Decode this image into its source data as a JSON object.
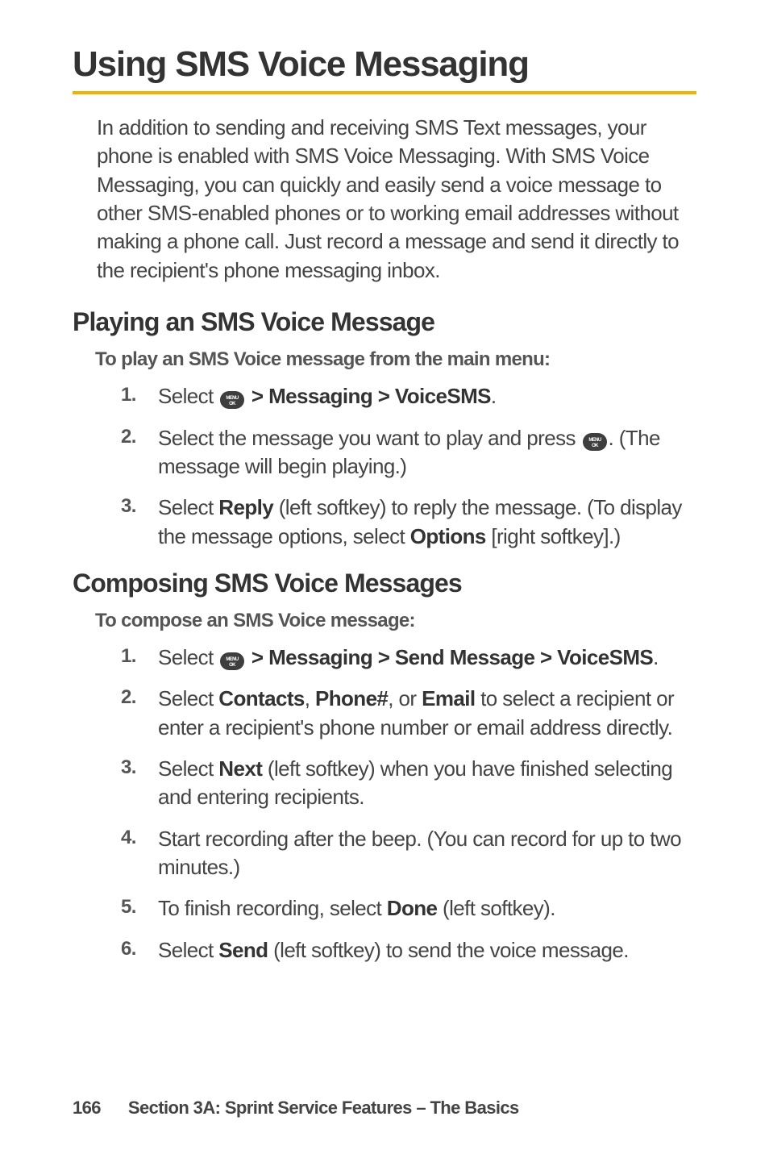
{
  "h1": "Using SMS Voice Messaging",
  "intro": "In addition to sending and receiving SMS Text messages, your phone is enabled with SMS Voice Messaging. With SMS Voice Messaging, you can quickly and easily send a voice message to other SMS-enabled phones or to working email addresses without making a phone call. Just record a message and send it directly to the recipient's phone messaging inbox.",
  "section1": {
    "h2": "Playing an SMS Voice Message",
    "lead": "To play an SMS Voice message from the main menu:",
    "steps": {
      "s1_a": "Select ",
      "s1_b": " > Messaging > VoiceSMS",
      "s1_c": ".",
      "s2_a": "Select the message you want to play and press ",
      "s2_b": ". (The message will begin playing.)",
      "s3_a": "Select ",
      "s3_reply": "Reply",
      "s3_b": " (left softkey) to reply the message. (To display the message options, select ",
      "s3_options": "Options",
      "s3_c": " [right softkey].)"
    }
  },
  "section2": {
    "h2": "Composing SMS Voice Messages",
    "lead": "To compose an SMS Voice message:",
    "steps": {
      "s1_a": "Select ",
      "s1_b": " > Messaging > Send Message > VoiceSMS",
      "s1_c": ".",
      "s2_a": "Select ",
      "s2_contacts": "Contacts",
      "s2_b": ", ",
      "s2_phone": "Phone#",
      "s2_c": ", or ",
      "s2_email": "Email",
      "s2_d": " to select a recipient or enter a recipient's phone number or email address directly.",
      "s3_a": "Select ",
      "s3_next": "Next",
      "s3_b": " (left softkey) when you have finished selecting and entering recipients.",
      "s4": "Start recording after the beep. (You can record for up to two minutes.)",
      "s5_a": "To finish recording, select ",
      "s5_done": "Done",
      "s5_b": " (left softkey).",
      "s6_a": "Select ",
      "s6_send": "Send",
      "s6_b": " (left softkey) to send the voice message."
    }
  },
  "footer": {
    "page": "166",
    "section": "Section 3A: Sprint Service Features – The Basics"
  }
}
